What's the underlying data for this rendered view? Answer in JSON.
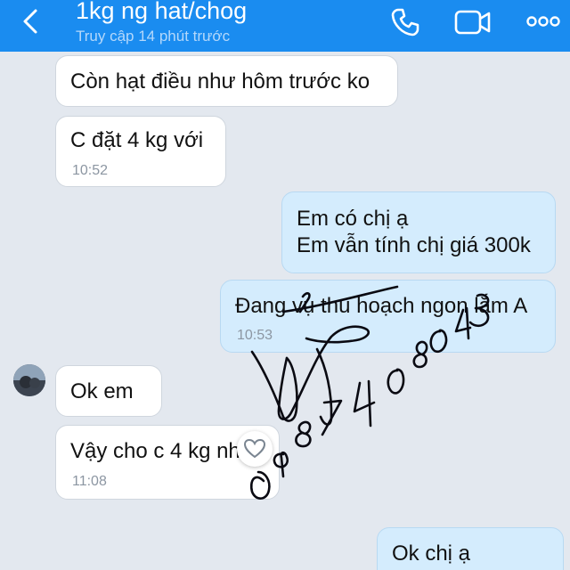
{
  "header": {
    "title": "1kg ng hat/chog",
    "subtitle": "Truy cập 14 phút trước",
    "back_icon": "chevron-left-icon",
    "call_icon": "phone-icon",
    "video_icon": "video-camera-icon",
    "more_icon": "more-dots-icon"
  },
  "messages": [
    {
      "from": "contact",
      "text": "Còn hạt điều như hôm trước ko"
    },
    {
      "from": "contact",
      "text": "C đặt 4 kg với",
      "time": "10:52"
    },
    {
      "from": "me",
      "lines": [
        "Em có chị ạ",
        "Em vẫn tính chị giá 300k"
      ]
    },
    {
      "from": "me",
      "text": "Đang vụ thu hoạch ngon lắm A",
      "time": "10:53"
    },
    {
      "from": "contact",
      "text": "Ok em"
    },
    {
      "from": "contact",
      "text": "Vậy cho c 4 kg nhé",
      "time": "11:08"
    },
    {
      "from": "me",
      "text": "Ok chị ạ"
    }
  ],
  "handwriting": {
    "number": "0987 40 80 43"
  },
  "colors": {
    "header": "#1a8cf0",
    "background": "#e3e8ef",
    "outgoing": "#d4ecfd",
    "incoming": "#ffffff"
  }
}
